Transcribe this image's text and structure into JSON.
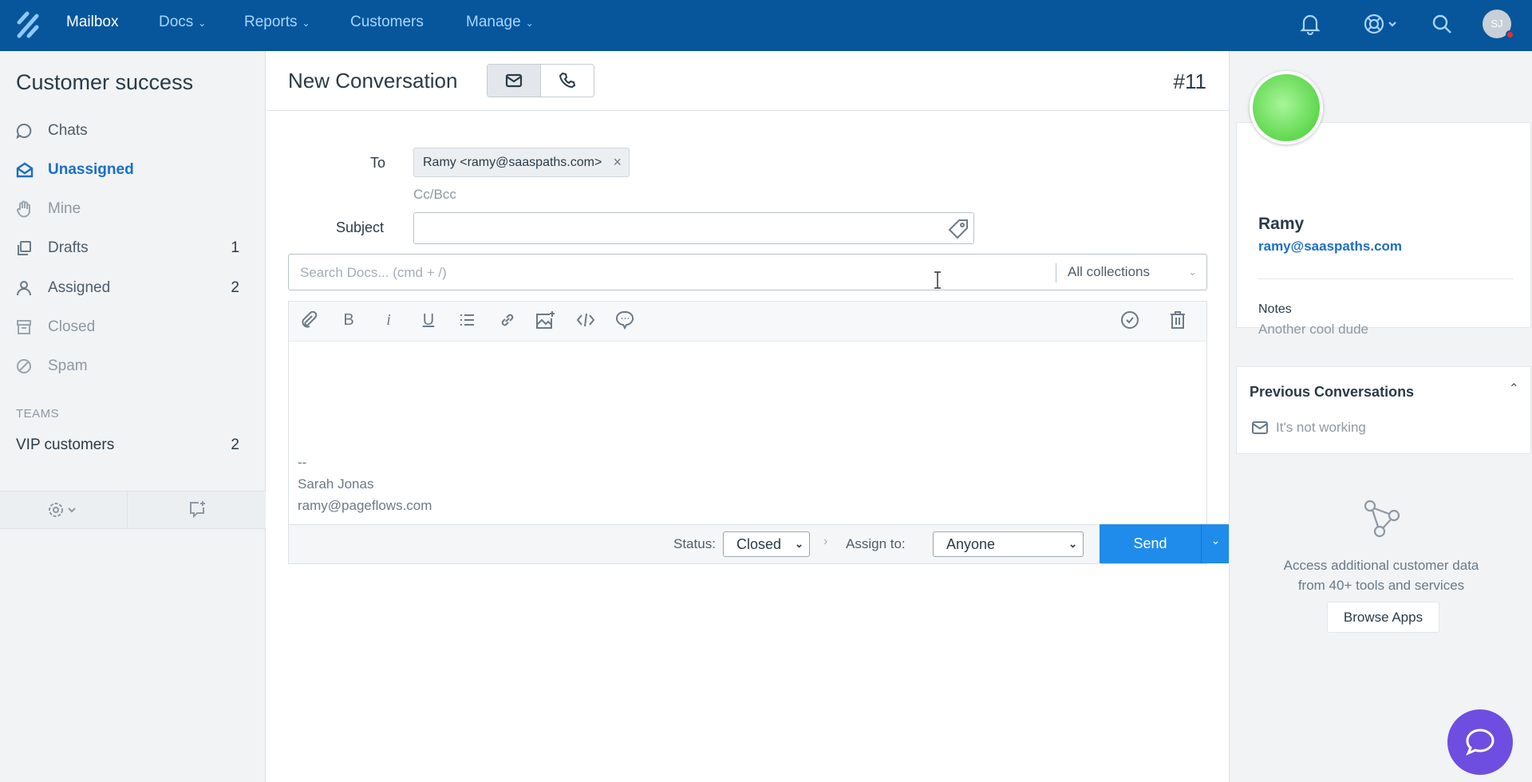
{
  "topnav": {
    "items": [
      {
        "label": "Mailbox",
        "active": true
      },
      {
        "label": "Docs",
        "dropdown": true
      },
      {
        "label": "Reports",
        "dropdown": true
      },
      {
        "label": "Customers"
      },
      {
        "label": "Manage",
        "dropdown": true
      }
    ],
    "avatar_initials": "SJ",
    "icons": [
      "logo-icon",
      "bell-icon",
      "help-lifebuoy-icon",
      "search-icon"
    ]
  },
  "sidebar": {
    "title": "Customer success",
    "items": [
      {
        "label": "Chats",
        "icon": "chat-icon",
        "count": ""
      },
      {
        "label": "Unassigned",
        "icon": "inbox-icon",
        "count": "",
        "selected": true
      },
      {
        "label": "Mine",
        "icon": "hand-icon",
        "count": ""
      },
      {
        "label": "Drafts",
        "icon": "drafts-icon",
        "count": "1"
      },
      {
        "label": "Assigned",
        "icon": "person-icon",
        "count": "2"
      },
      {
        "label": "Closed",
        "icon": "archive-icon",
        "count": ""
      },
      {
        "label": "Spam",
        "icon": "ban-icon",
        "count": ""
      }
    ],
    "teams_heading": "TEAMS",
    "teams": [
      {
        "label": "VIP customers",
        "count": "2"
      }
    ]
  },
  "conversation": {
    "title": "New Conversation",
    "number": "#11",
    "to_label": "To",
    "recipient": "Ramy <ramy@saaspaths.com>",
    "cc_bcc": "Cc/Bcc",
    "subject_label": "Subject",
    "subject_value": "",
    "docs_search_placeholder": "Search Docs... (cmd + /)",
    "collections": "All collections",
    "signature": [
      "--",
      "Sarah Jonas",
      "ramy@pageflows.com"
    ],
    "status_label": "Status:",
    "status_value": "Closed",
    "assign_label": "Assign to:",
    "assign_value": "Anyone",
    "send_label": "Send"
  },
  "customer": {
    "name": "Ramy",
    "email": "ramy@saaspaths.com",
    "notes_label": "Notes",
    "notes": "Another cool dude",
    "prev_title": "Previous Conversations",
    "prev_items": [
      "It's not working"
    ],
    "apps_text_1": "Access additional customer data",
    "apps_text_2": "from 40+ tools and services",
    "browse_apps": "Browse Apps"
  },
  "colors": {
    "topbar": "#07569c",
    "accent": "#1a6ec7",
    "send": "#1f8ceb",
    "chat_bubble": "#6d4ee0"
  }
}
